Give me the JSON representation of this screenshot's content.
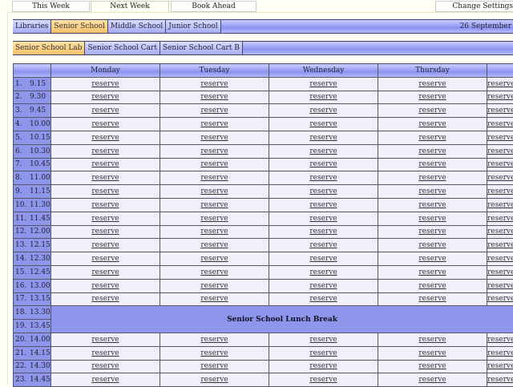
{
  "top_tabs": [
    "This Week",
    "Next Week",
    "Book Ahead"
  ],
  "active_top_tab": "Next Week",
  "settings_label": "Change Settings",
  "school_tabs": [
    "Libraries",
    "Senior School",
    "Middle School",
    "Junior School"
  ],
  "selected_school": "Senior School",
  "date": "26 September",
  "room_tabs": [
    "Senior School Lab",
    "Senior School Cart",
    "Senior School Cart B"
  ],
  "selected_room": "Senior School Lab",
  "days": [
    "Monday",
    "Tuesday",
    "Wednesday",
    "Thursday",
    ""
  ],
  "reserve_label": "reserve",
  "lunch_label": "Senior School Lunch Break",
  "periods": [
    {
      "n": "1.",
      "t": "9.15"
    },
    {
      "n": "2.",
      "t": "9.30"
    },
    {
      "n": "3.",
      "t": "9.45"
    },
    {
      "n": "4.",
      "t": "10.00"
    },
    {
      "n": "5.",
      "t": "10.15"
    },
    {
      "n": "6.",
      "t": "10.30"
    },
    {
      "n": "7.",
      "t": "10.45"
    },
    {
      "n": "8.",
      "t": "11.00"
    },
    {
      "n": "9.",
      "t": "11.15"
    },
    {
      "n": "10.",
      "t": "11.30"
    },
    {
      "n": "11.",
      "t": "11.45"
    },
    {
      "n": "12.",
      "t": "12.00"
    },
    {
      "n": "13.",
      "t": "12.15"
    },
    {
      "n": "14.",
      "t": "12.30"
    },
    {
      "n": "15.",
      "t": "12.45"
    },
    {
      "n": "16.",
      "t": "13.00"
    },
    {
      "n": "17.",
      "t": "13.15"
    },
    {
      "n": "18.",
      "t": "13.30",
      "lunch": true
    },
    {
      "n": "19.",
      "t": "13.45",
      "lunch": true
    },
    {
      "n": "20.",
      "t": "14.00"
    },
    {
      "n": "21.",
      "t": "14.15"
    },
    {
      "n": "22.",
      "t": "14.30"
    },
    {
      "n": "23.",
      "t": "14.45"
    }
  ]
}
